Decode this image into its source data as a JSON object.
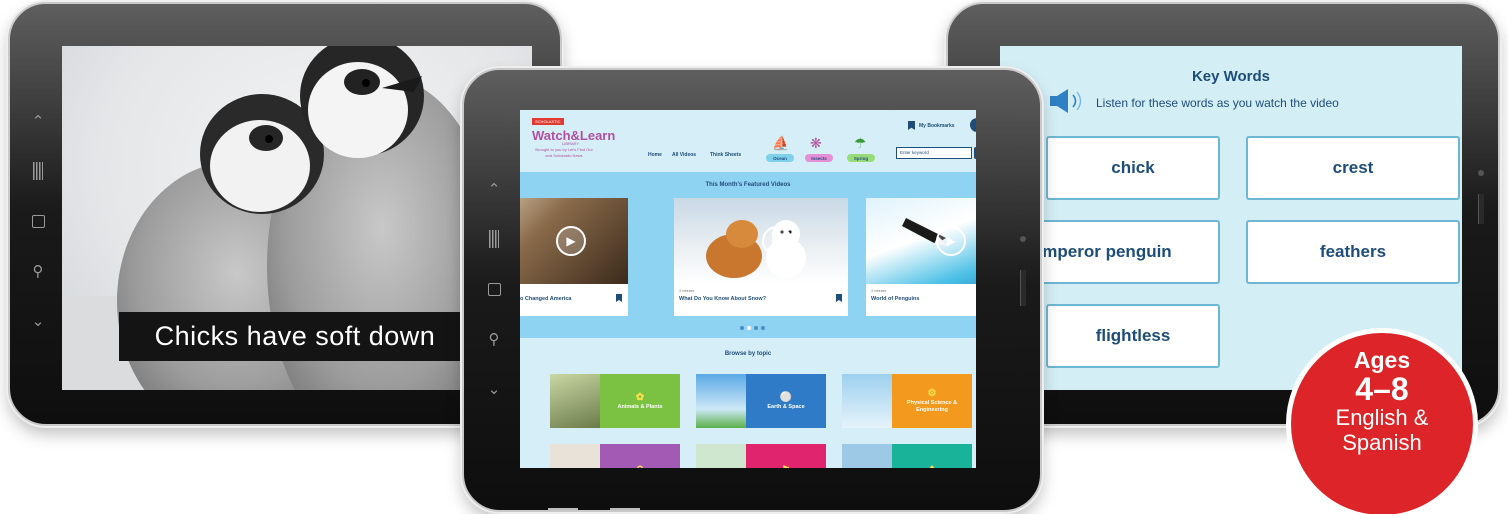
{
  "left_tablet": {
    "caption": "Chicks have soft down"
  },
  "right_tablet": {
    "title": "Key Words",
    "instruction": "Listen for these words as you watch the video",
    "words": [
      "chick",
      "crest",
      "mperor penguin",
      "feathers",
      "flightless"
    ]
  },
  "center_tablet": {
    "header": {
      "brand_badge": "SCHOLASTIC",
      "brand_title": "Watch&Learn",
      "brand_sub": "LIBRARY",
      "tagline": "Brought to you by Let's Find Out and Scholastic News",
      "nav": [
        "Home",
        "All Videos",
        "Think Sheets"
      ],
      "topics": [
        {
          "label": "Ocean",
          "color": "#7fd0ea",
          "icon": "sailboat-icon"
        },
        {
          "label": "Insects",
          "color": "#e48fd6",
          "icon": "butterfly-icon"
        },
        {
          "label": "Spring",
          "color": "#98dc7a",
          "icon": "umbrella-icon"
        }
      ],
      "bookmarks": "My Bookmarks",
      "search_placeholder": "Enter keyword"
    },
    "featured": {
      "title": "This Month's Featured Videos",
      "videos": [
        {
          "duration": "",
          "title": "o Changed America"
        },
        {
          "duration": "3 minutes",
          "title": "What Do You Know About Snow?"
        },
        {
          "duration": "3 minutes",
          "title": "World of Penguins"
        }
      ]
    },
    "browse": {
      "title": "Browse by topic",
      "topics": [
        {
          "label": "Animals & Plants",
          "color": "#7cc242"
        },
        {
          "label": "Earth & Space",
          "color": "#2f7bc8"
        },
        {
          "label": "Physical Science & Engineering",
          "color": "#f39a1e"
        },
        {
          "label": "",
          "color": "#a25ab5"
        },
        {
          "label": "",
          "color": "#e0246e"
        },
        {
          "label": "",
          "color": "#19b39a"
        }
      ]
    }
  },
  "badge": {
    "line1": "Ages",
    "line2": "4–8",
    "line3": "English &",
    "line4": "Spanish"
  }
}
